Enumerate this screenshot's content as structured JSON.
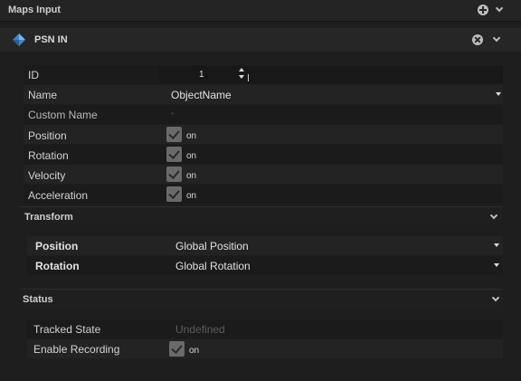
{
  "header": {
    "title": "Maps Input",
    "add_icon": "plus-circle-icon",
    "collapse_icon": "chevron-down-icon"
  },
  "psn": {
    "title": "PSN IN",
    "icon": "diamond-icon",
    "remove_icon": "close-circle-icon",
    "collapse_icon": "chevron-down-icon"
  },
  "properties": {
    "id": {
      "label": "ID",
      "value": "1"
    },
    "name": {
      "label": "Name",
      "value": "ObjectName"
    },
    "custom_name": {
      "label": "Custom Name",
      "value": "-"
    },
    "position": {
      "label": "Position",
      "state": "on"
    },
    "rotation": {
      "label": "Rotation",
      "state": "on"
    },
    "velocity": {
      "label": "Velocity",
      "state": "on"
    },
    "acceleration": {
      "label": "Acceleration",
      "state": "on"
    }
  },
  "transform": {
    "title": "Transform",
    "position": {
      "label": "Position",
      "value": "Global Position"
    },
    "rotation": {
      "label": "Rotation",
      "value": "Global Rotation"
    }
  },
  "status": {
    "title": "Status",
    "tracked_state": {
      "label": "Tracked State",
      "value": "Undefined"
    },
    "enable_recording": {
      "label": "Enable Recording",
      "state": "on"
    }
  },
  "colors": {
    "background": "#1e1e1e",
    "checkbox": "#6a6a6a",
    "accent_icon": "#4a8fd0"
  }
}
